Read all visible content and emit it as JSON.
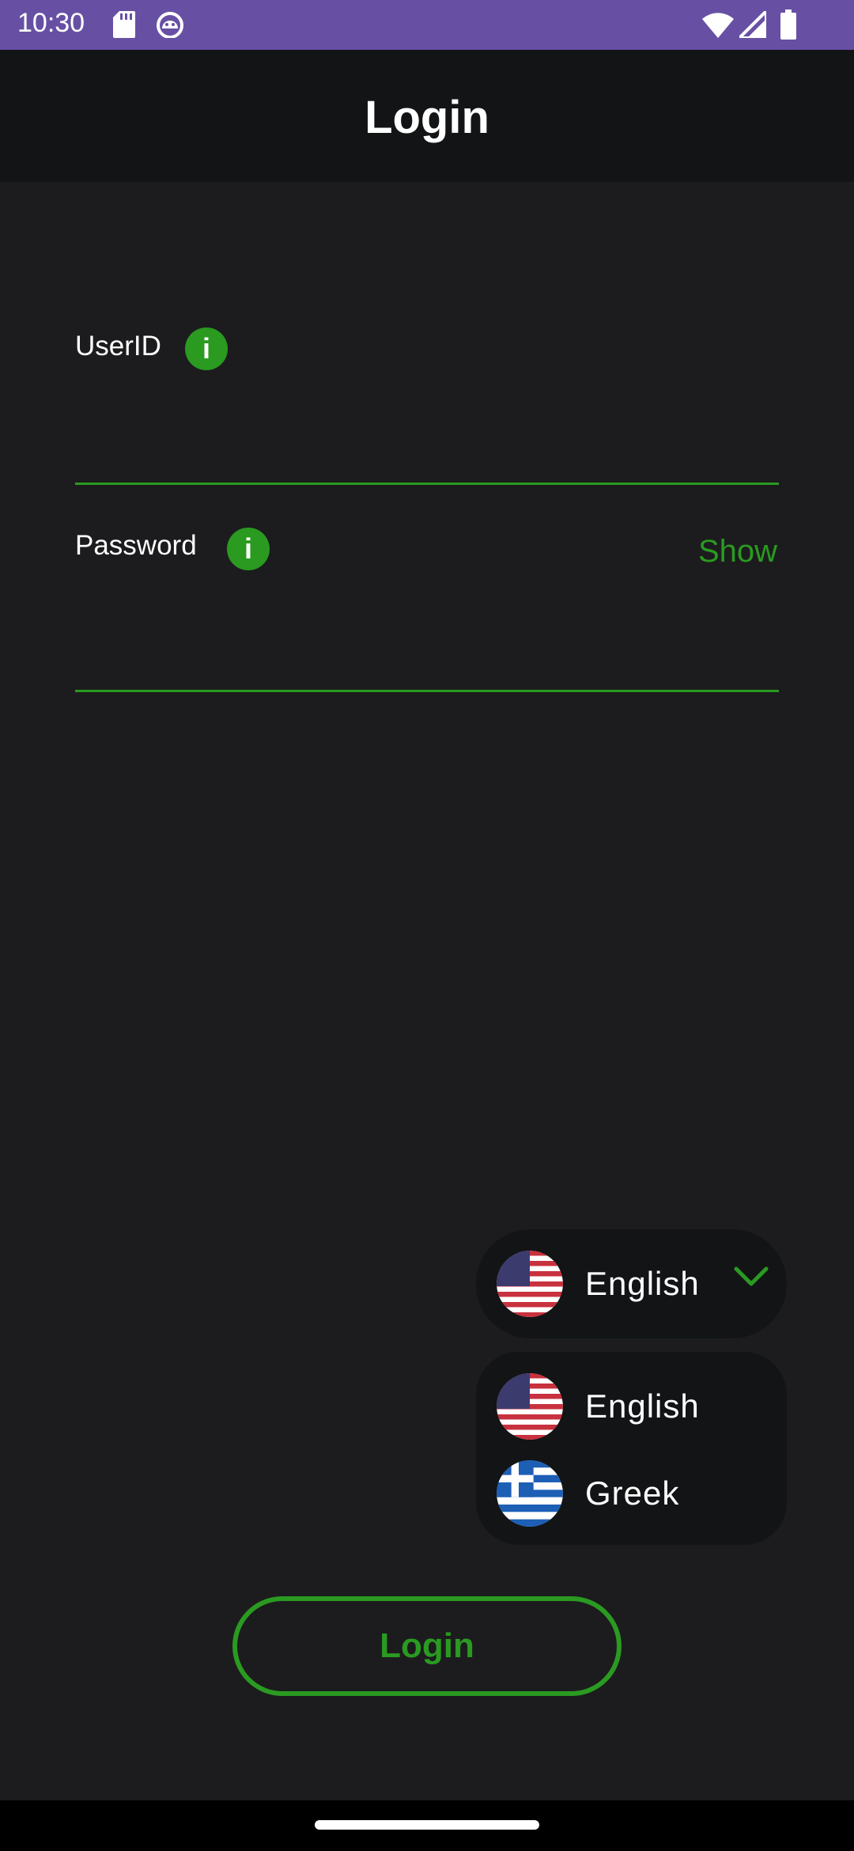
{
  "status_bar": {
    "time": "10:30",
    "icons": [
      "sd-card-icon",
      "android-debug-icon",
      "wifi-icon",
      "signal-icon",
      "battery-icon"
    ]
  },
  "top_bar": {
    "title": "Login"
  },
  "userid": {
    "label": "UserID",
    "info_symbol": "i",
    "value": "",
    "placeholder": ""
  },
  "password": {
    "label": "Password",
    "info_symbol": "i",
    "value": "",
    "placeholder": "",
    "show_label": "Show"
  },
  "language": {
    "selected": "English",
    "options": [
      {
        "label": "English",
        "flag": "us-flag-icon"
      },
      {
        "label": "Greek",
        "flag": "greece-flag-icon"
      }
    ]
  },
  "login_button": {
    "label": "Login"
  },
  "colors": {
    "accent": "#2a9a21",
    "status_bar": "#6750a4",
    "app_bar": "#121416",
    "background": "#1c1c1e"
  }
}
